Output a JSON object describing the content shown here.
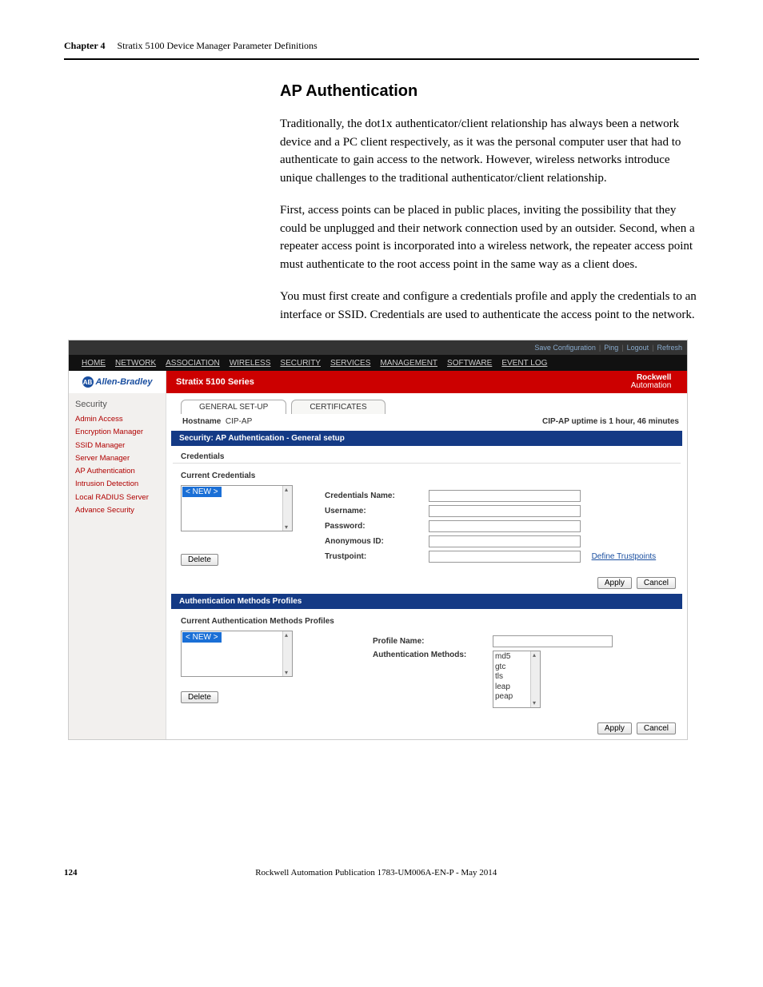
{
  "header": {
    "chapter": "Chapter 4",
    "title": "Stratix 5100 Device Manager Parameter Definitions"
  },
  "section": {
    "heading": "AP Authentication",
    "p1": "Traditionally, the dot1x authenticator/client relationship has always been a network device and a PC client respectively, as it was the personal computer user that had to authenticate to gain access to the network. However, wireless networks introduce unique challenges to the traditional authenticator/client relationship.",
    "p2": "First, access points can be placed in public places, inviting the possibility that they could be unplugged and their network connection used by an outsider. Second, when a repeater access point is incorporated into a wireless network, the repeater access point must authenticate to the root access point in the same way as a client does.",
    "p3": "You must first create and configure a credentials profile and apply the credentials to an interface or SSID. Credentials are used to authenticate the access point to the network."
  },
  "ui": {
    "toplinks": [
      "Save Configuration",
      "Ping",
      "Logout",
      "Refresh"
    ],
    "mainnav": [
      "HOME",
      "NETWORK",
      "ASSOCIATION",
      "WIRELESS",
      "SECURITY",
      "SERVICES",
      "MANAGEMENT",
      "SOFTWARE",
      "EVENT LOG"
    ],
    "brand_left": "Allen-Bradley",
    "brand_series": "Stratix 5100 Series",
    "brand_right": "Rockwell Automation",
    "sidebar_title": "Security",
    "sidebar_items": [
      "Admin Access",
      "Encryption Manager",
      "SSID Manager",
      "Server Manager",
      "AP Authentication",
      "Intrusion Detection",
      "Local RADIUS Server",
      "Advance Security"
    ],
    "tab1": "GENERAL SET-UP",
    "tab2": "CERTIFICATES",
    "hostname_label": "Hostname",
    "hostname_value": "CIP-AP",
    "uptime": "CIP-AP uptime is 1 hour, 46 minutes",
    "bluebar1": "Security: AP Authentication - General setup",
    "credentials_label": "Credentials",
    "current_credentials": "Current Credentials",
    "new_item": "< NEW >",
    "cred_fields": {
      "name": "Credentials Name:",
      "user": "Username:",
      "pass": "Password:",
      "anon": "Anonymous ID:",
      "trust": "Trustpoint:"
    },
    "define_tp": "Define Trustpoints",
    "delete": "Delete",
    "apply": "Apply",
    "cancel": "Cancel",
    "bluebar2": "Authentication Methods Profiles",
    "current_auth_profiles": "Current Authentication Methods Profiles",
    "profile_name": "Profile Name:",
    "auth_methods_label": "Authentication Methods:",
    "auth_methods": [
      "md5",
      "gtc",
      "tls",
      "leap",
      "peap"
    ]
  },
  "footer": {
    "page": "124",
    "pub": "Rockwell Automation Publication 1783-UM006A-EN-P - May 2014"
  }
}
